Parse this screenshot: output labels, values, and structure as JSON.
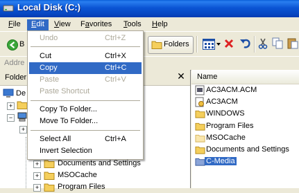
{
  "window": {
    "title": "Local Disk (C:)"
  },
  "menubar": {
    "items": [
      {
        "label": "File",
        "underline_index": 0
      },
      {
        "label": "Edit",
        "underline_index": 0
      },
      {
        "label": "View",
        "underline_index": 0
      },
      {
        "label": "Favorites",
        "underline_index": 1
      },
      {
        "label": "Tools",
        "underline_index": 0
      },
      {
        "label": "Help",
        "underline_index": 0
      }
    ]
  },
  "toolbar": {
    "back_label": "B",
    "folders_label": "Folders"
  },
  "addressbar": {
    "label": "Addre"
  },
  "folders_pane": {
    "header_label": "Folder",
    "close_glyph": "✕",
    "top_label": "De",
    "tree_items": [
      {
        "label": "Documents and Settings"
      },
      {
        "label": "MSOCache"
      },
      {
        "label": "Program Files"
      }
    ]
  },
  "right_pane": {
    "column_header": "Name",
    "files": [
      {
        "name": "AC3ACM.ACM",
        "icon": "acm-file-icon"
      },
      {
        "name": "AC3ACM",
        "icon": "setup-info-icon"
      },
      {
        "name": "WINDOWS",
        "icon": "folder-icon"
      },
      {
        "name": "Program Files",
        "icon": "folder-icon"
      },
      {
        "name": "MSOCache",
        "icon": "hidden-folder-icon"
      },
      {
        "name": "Documents and Settings",
        "icon": "folder-icon"
      },
      {
        "name": "C-Media",
        "icon": "folder-icon",
        "selected": true
      }
    ]
  },
  "edit_menu": {
    "items": [
      {
        "label": "Undo",
        "shortcut": "Ctrl+Z",
        "disabled": true
      },
      {
        "separator": true
      },
      {
        "label": "Cut",
        "shortcut": "Ctrl+X"
      },
      {
        "label": "Copy",
        "shortcut": "Ctrl+C",
        "hover": true
      },
      {
        "label": "Paste",
        "shortcut": "Ctrl+V",
        "disabled": true
      },
      {
        "label": "Paste Shortcut",
        "shortcut": "",
        "disabled": true
      },
      {
        "separator": true
      },
      {
        "label": "Copy To Folder...",
        "shortcut": ""
      },
      {
        "label": "Move To Folder...",
        "shortcut": ""
      },
      {
        "separator": true
      },
      {
        "label": "Select All",
        "shortcut": "Ctrl+A"
      },
      {
        "label": "Invert Selection",
        "shortcut": ""
      }
    ]
  },
  "colors": {
    "selection": "#316ac5",
    "titlebar": "#0b55d4",
    "menu_bg": "#ece9d8",
    "folder": "#f5cf5c"
  }
}
